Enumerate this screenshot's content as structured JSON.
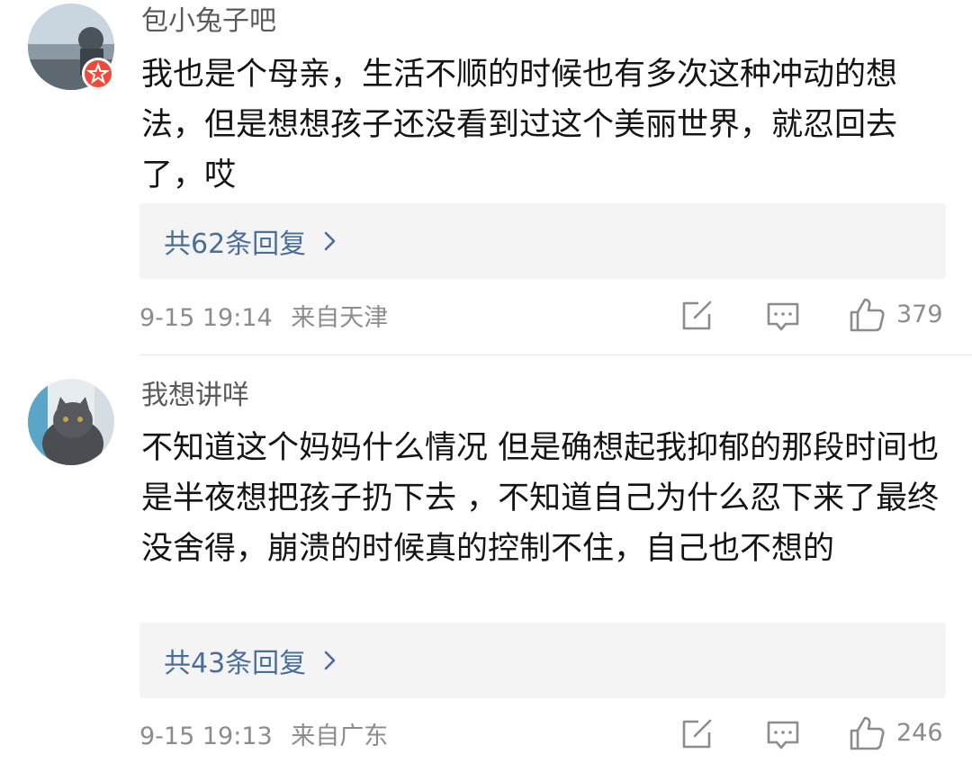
{
  "comments": [
    {
      "username": "包小兔子吧",
      "text": "我也是个母亲，生活不顺的时候也有多次这种冲动的想法，但是想想孩子还没看到过这个美丽世界，就忍回去了，哎",
      "replies_label": "共62条回复",
      "timestamp": "9-15 19:14",
      "location": "来自天津",
      "likes": "379",
      "avatar_icon": "avatar-photo",
      "badge_icon": "verified-badge-icon"
    },
    {
      "username": "我想讲咩",
      "text": "不知道这个妈妈什么情况 但是确想起我抑郁的那段时间也是半夜想把孩子扔下去 ，不知道自己为什么忍下来了最终没舍得，崩溃的时候真的控制不住，自己也不想的",
      "replies_label": "共43条回复",
      "timestamp": "9-15 19:13",
      "location": "来自广东",
      "likes": "246",
      "avatar_icon": "cat-avatar"
    }
  ],
  "colors": {
    "link": "#4a6e98",
    "meta": "#8c8c8c",
    "badge": "#f04a3a",
    "reply_bg": "#f4f4f4"
  },
  "icons": [
    "share-icon",
    "reply-icon",
    "like-icon",
    "chevron-right-icon"
  ]
}
